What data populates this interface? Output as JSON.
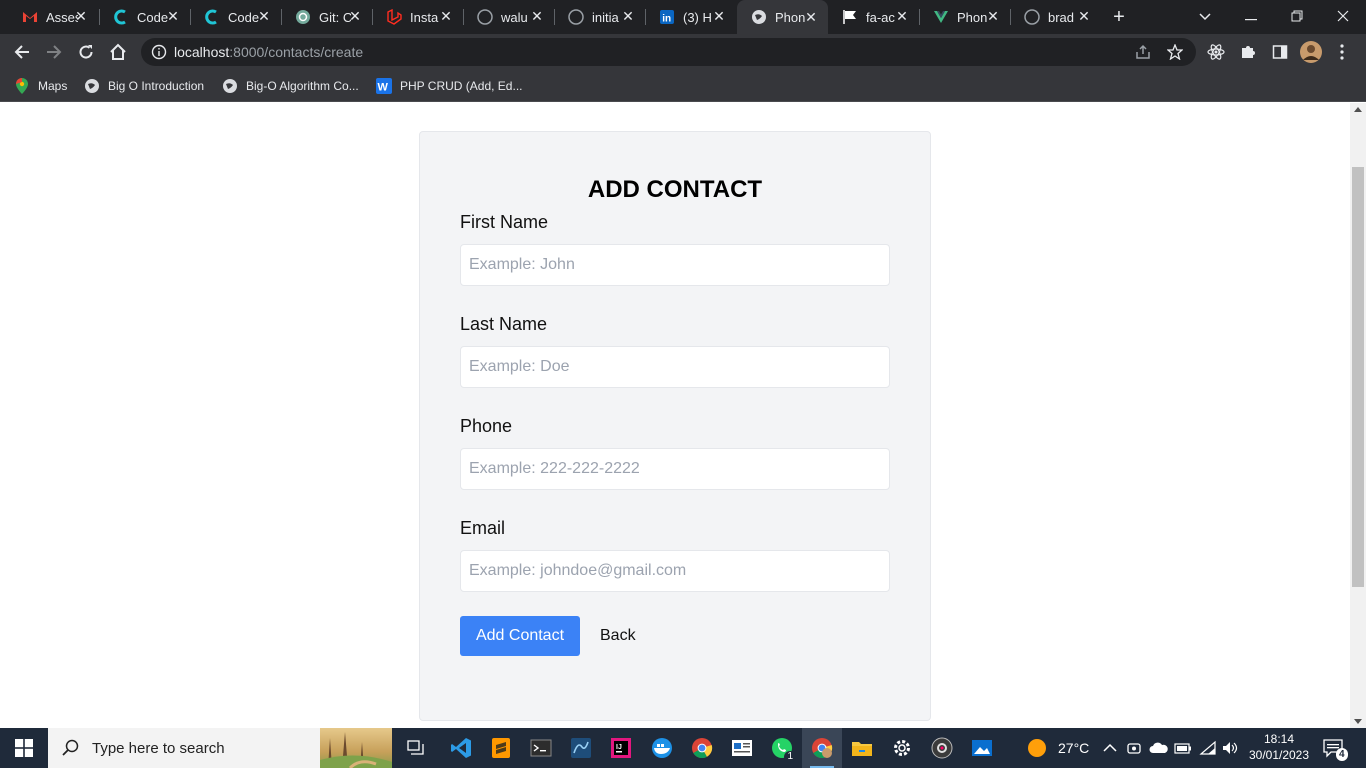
{
  "browser": {
    "tabs": [
      {
        "title": "Assess"
      },
      {
        "title": "Code"
      },
      {
        "title": "Code"
      },
      {
        "title": "Git: C"
      },
      {
        "title": "Insta"
      },
      {
        "title": "walu"
      },
      {
        "title": "initia"
      },
      {
        "title": "(3) H"
      },
      {
        "title": "Phon"
      },
      {
        "title": "fa-ac"
      },
      {
        "title": "Phon"
      },
      {
        "title": "brad"
      }
    ],
    "url_host": "localhost",
    "url_rest": ":8000/contacts/create",
    "bookmarks": [
      {
        "label": "Maps"
      },
      {
        "label": "Big O Introduction"
      },
      {
        "label": "Big-O Algorithm Co..."
      },
      {
        "label": "PHP CRUD (Add, Ed..."
      }
    ]
  },
  "form": {
    "title": "ADD CONTACT",
    "first_name": {
      "label": "First Name",
      "placeholder": "Example: John"
    },
    "last_name": {
      "label": "Last Name",
      "placeholder": "Example: Doe"
    },
    "phone": {
      "label": "Phone",
      "placeholder": "Example: 222-222-2222"
    },
    "email": {
      "label": "Email",
      "placeholder": "Example: johndoe@gmail.com"
    },
    "submit_label": "Add Contact",
    "back_label": "Back",
    "colors": {
      "primary": "#3b82f6",
      "card": "#f3f4f6"
    }
  },
  "taskbar": {
    "search_placeholder": "Type here to search",
    "weather": "27°C",
    "time": "18:14",
    "date": "30/01/2023",
    "whatsapp_badge": "1",
    "notifications": "4"
  }
}
